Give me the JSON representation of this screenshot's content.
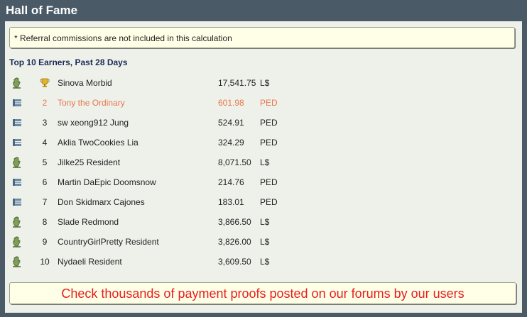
{
  "window": {
    "title": "Hall of Fame"
  },
  "note": {
    "text": "* Referral commissions are not included in this calculation"
  },
  "leaderboard": {
    "heading": "Top 10 Earners, Past 28 Days",
    "rows": [
      {
        "icon": "sl-hand-icon",
        "rank": "",
        "rank_icon": "trophy-icon",
        "name": "Sinova Morbid",
        "amount": "17,541.75",
        "currency": "L$"
      },
      {
        "icon": "entropia-icon",
        "rank": "2",
        "name": "Tony the Ordinary",
        "amount": "601.98",
        "currency": "PED",
        "highlight": true
      },
      {
        "icon": "entropia-icon",
        "rank": "3",
        "name": "sw xeong912 Jung",
        "amount": "524.91",
        "currency": "PED"
      },
      {
        "icon": "entropia-icon",
        "rank": "4",
        "name": "Aklia TwoCookies Lia",
        "amount": "324.29",
        "currency": "PED"
      },
      {
        "icon": "sl-hand-icon",
        "rank": "5",
        "name": "Jilke25 Resident",
        "amount": "8,071.50",
        "currency": "L$"
      },
      {
        "icon": "entropia-icon",
        "rank": "6",
        "name": "Martin DaEpic Doomsnow",
        "amount": "214.76",
        "currency": "PED"
      },
      {
        "icon": "entropia-icon",
        "rank": "7",
        "name": "Don Skidmarx Cajones",
        "amount": "183.01",
        "currency": "PED"
      },
      {
        "icon": "sl-hand-icon",
        "rank": "8",
        "name": "Slade Redmond",
        "amount": "3,866.50",
        "currency": "L$"
      },
      {
        "icon": "sl-hand-icon",
        "rank": "9",
        "name": "CountryGirlPretty Resident",
        "amount": "3,826.00",
        "currency": "L$"
      },
      {
        "icon": "sl-hand-icon",
        "rank": "10",
        "name": "Nydaeli Resident",
        "amount": "3,609.50",
        "currency": "L$"
      }
    ]
  },
  "promo": {
    "text": "Check thousands of payment proofs posted on our forums by our users"
  },
  "colors": {
    "background": "#4a5a66",
    "panel": "#eef1ea",
    "note_bg": "#ffffe8",
    "highlight": "#e8754c",
    "promo_text": "#e61e1e",
    "heading": "#1a2a55"
  }
}
